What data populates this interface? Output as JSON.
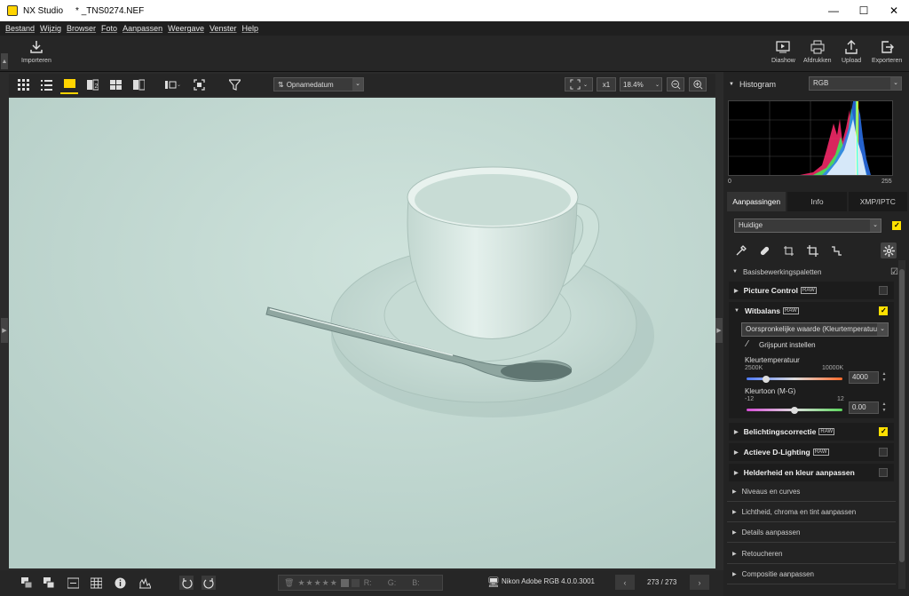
{
  "window": {
    "app": "NX Studio",
    "file": "* _TNS0274.NEF",
    "minimize": "—",
    "maximize": "☐",
    "close": "✕"
  },
  "menu": [
    "Bestand",
    "Wijzig",
    "Browser",
    "Foto",
    "Aanpassen",
    "Weergave",
    "Venster",
    "Help"
  ],
  "toolbar": {
    "import": "Importeren",
    "slideshow": "Diashow",
    "print": "Afdrukken",
    "upload": "Upload",
    "export": "Exporteren"
  },
  "viewbar": {
    "sort": "Opnamedatum",
    "zoom_ratio": "x1",
    "zoom": "18.4%"
  },
  "bottombar": {
    "profile": "Nikon Adobe RGB 4.0.0.3001",
    "counter": "273 / 273",
    "rating_r": "R:",
    "rating_g": "G:",
    "rating_b": "B:",
    "rating_stars": 0
  },
  "histogram": {
    "label": "Histogram",
    "channel": "RGB",
    "min": "0",
    "max": "255"
  },
  "tabs": [
    "Aanpassingen",
    "Info",
    "XMP/IPTC"
  ],
  "preset": "Huidige",
  "basic": "Basisbewerkingspaletten",
  "palettes": {
    "picture_control": "Picture Control",
    "white_balance": "Witbalans",
    "wb_mode": "Oorspronkelijke waarde (Kleurtemperatuur)",
    "grey_point": "Grijspunt instellen",
    "temp_label": "Kleurtemperatuur",
    "temp_min": "2500K",
    "temp_max": "10000K",
    "temp_value": "4000",
    "tint_label": "Kleurtoon (M-G)",
    "tint_min": "-12",
    "tint_max": "12",
    "tint_value": "0.00",
    "exposure": "Belichtingscorrectie",
    "adl": "Actieve D-Lighting",
    "brightness": "Helderheid en kleur aanpassen"
  },
  "raw_badge": "RAW",
  "collapsed": [
    "Niveaus en curves",
    "Lichtheid, chroma en tint aanpassen",
    "Details aanpassen",
    "Retoucheren",
    "Compositie aanpassen"
  ]
}
